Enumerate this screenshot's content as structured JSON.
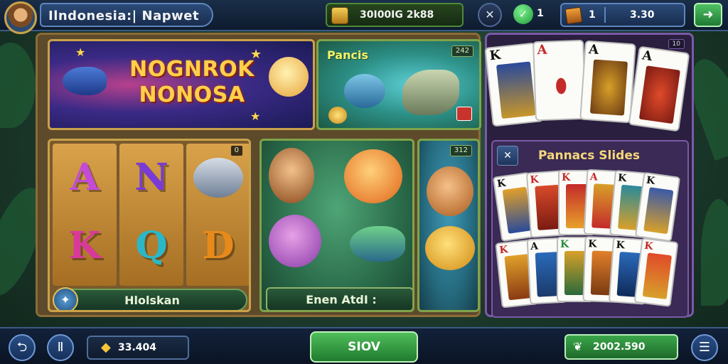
{
  "header": {
    "title": "Ilndonesia:| Napwet",
    "coins": "30I00IG 2k88",
    "check_count": "1",
    "gem_count": "1",
    "gem_value": "3.30"
  },
  "lobby": {
    "banner_title": "NOGNROK NONOSA",
    "pancis_title": "Pancis",
    "pancis_badge": "242",
    "slots_badge": "0",
    "slots_label": "Hlolskan",
    "slot_symbols": [
      "A",
      "N",
      "K",
      "Q",
      "D"
    ],
    "fish_label": "Enen AtdI :",
    "goldfish_badge": "312"
  },
  "cards": {
    "top_badge": "10",
    "slides_title": "Pannacs Slides",
    "top_cards": [
      "K",
      "A",
      "A",
      "A"
    ],
    "slide_cards_row1": [
      "K",
      "K",
      "K",
      "A",
      "K",
      "K"
    ],
    "slide_cards_row2": [
      "K",
      "A",
      "K",
      "K",
      "K",
      "K"
    ]
  },
  "footer": {
    "balance": "33.404",
    "main_button": "SIOV",
    "win_value": "2002.590"
  },
  "colors": {
    "accent_gold": "#c9a24a",
    "button_green": "#3aa64a",
    "frame_purple": "#7a5aa8"
  }
}
